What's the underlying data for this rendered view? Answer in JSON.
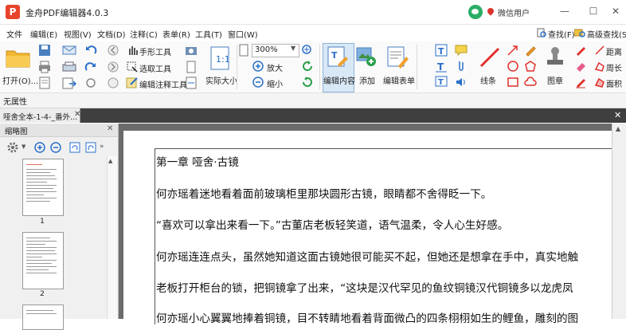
{
  "app": {
    "logo_letter": "P",
    "title": "金舟PDF编辑器4.0.3",
    "user_label": "微信用户"
  },
  "window_buttons": {
    "minimize": "—",
    "maximize": "☐",
    "close": "✕"
  },
  "menu": [
    "文件",
    "编辑(E)",
    "视图(V)",
    "文档(D)",
    "注释(C)",
    "表单(R)",
    "工具(T)",
    "窗口(W)"
  ],
  "search": {
    "find_label": "查找(F)",
    "advanced_find_label": "高级查找(S)"
  },
  "toolbar": {
    "open_label": "打开(O)...",
    "hand_tool": "手形工具",
    "select_tool": "选取工具",
    "edit_annotation_tool": "编辑注释工具",
    "actual_size": "实际大小",
    "zoom_value": "300%",
    "zoom_in": "放大",
    "zoom_out": "缩小",
    "edit_content": "编辑内容",
    "add": "添加",
    "edit_form": "编辑表单",
    "line": "线条",
    "stamp": "图章",
    "distance": "距离",
    "perimeter": "周长",
    "area": "面积"
  },
  "property_bar": {
    "label": "无属性"
  },
  "tabs": {
    "document_tab": "哑舍全本-1-4-_番外..."
  },
  "thumbnail_panel": {
    "title": "缩略图",
    "pages": [
      "1",
      "2"
    ]
  },
  "document": {
    "lines": [
      "第一章 哑舍·古镜",
      "何亦瑶着迷地看着面前玻璃柜里那块圆形古镜，眼睛都不舍得眨一下。",
      "“喜欢可以拿出来看一下。”古董店老板轻笑道，语气温柔，令人心生好感。",
      "何亦瑶连连点头，虽然她知道这面古镜她很可能买不起，但她还是想拿在手中，真实地触",
      "老板打开柜台的锁，把铜镜拿了出来，“这块是汉代罕见的鱼纹铜镜汉代铜镜多以龙虎凤",
      "何亦瑶小心翼翼地捧着铜镜，目不转睛地看着背面微凸的四条栩栩如生的鲤鱼，雕刻的图"
    ]
  }
}
